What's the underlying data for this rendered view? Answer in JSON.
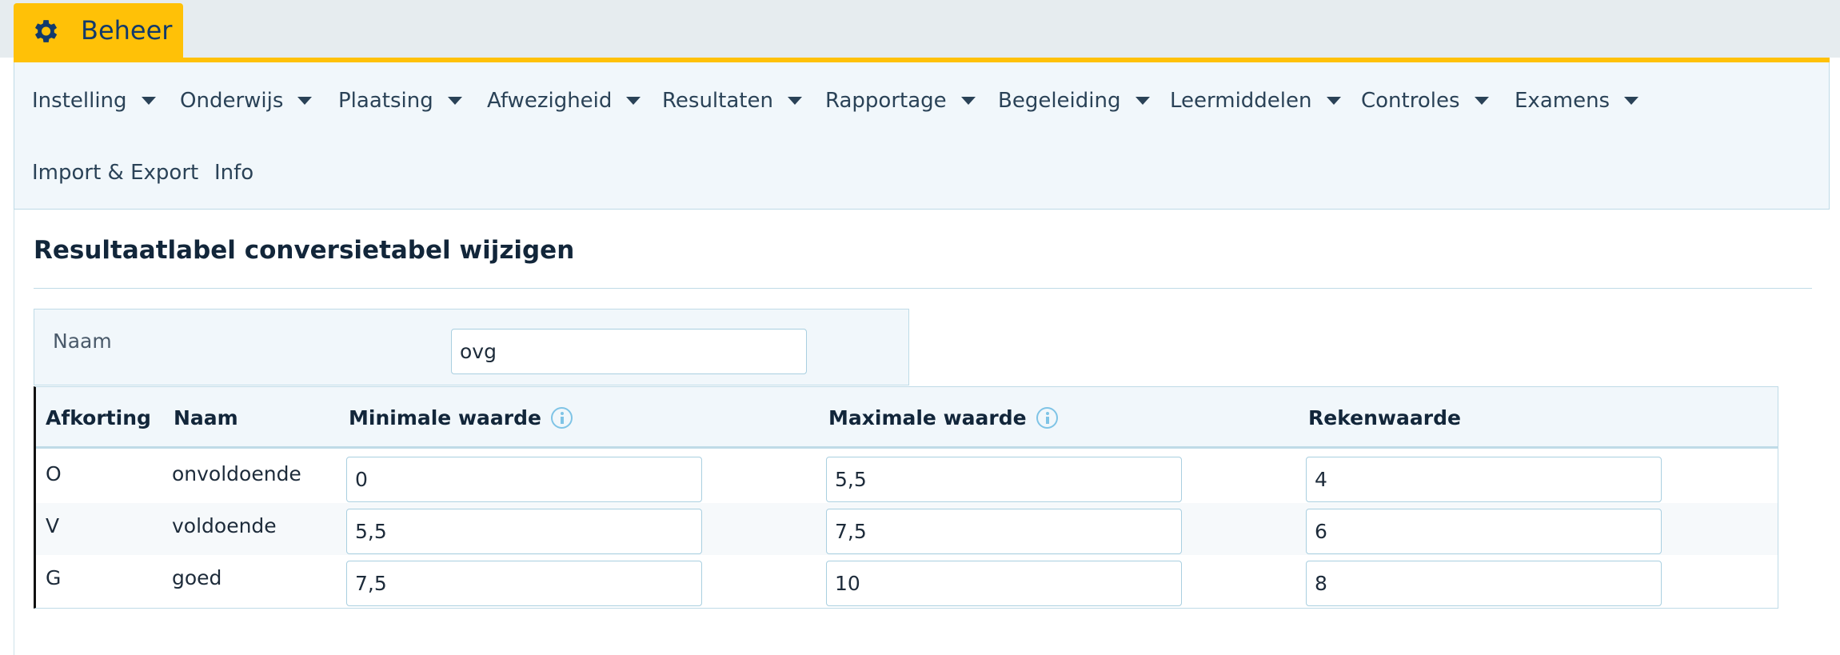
{
  "app": {
    "tab_label": "Beheer",
    "accent_color": "#ffc107",
    "brand_color": "#123a6b"
  },
  "menu": {
    "items": [
      {
        "label": "Instelling",
        "has_dropdown": true
      },
      {
        "label": "Onderwijs",
        "has_dropdown": true
      },
      {
        "label": "Plaatsing",
        "has_dropdown": true
      },
      {
        "label": "Afwezigheid",
        "has_dropdown": true
      },
      {
        "label": "Resultaten",
        "has_dropdown": true
      },
      {
        "label": "Rapportage",
        "has_dropdown": true
      },
      {
        "label": "Begeleiding",
        "has_dropdown": true
      },
      {
        "label": "Leermiddelen",
        "has_dropdown": true
      },
      {
        "label": "Controles",
        "has_dropdown": true
      },
      {
        "label": "Examens",
        "has_dropdown": true
      },
      {
        "label": "Import & Export",
        "has_dropdown": false
      },
      {
        "label": "Info",
        "has_dropdown": false
      }
    ]
  },
  "page": {
    "title": "Resultaatlabel conversietabel wijzigen"
  },
  "form": {
    "name_label": "Naam",
    "name_value": "ovg"
  },
  "table": {
    "headers": {
      "abbr": "Afkorting",
      "name": "Naam",
      "min": "Minimale waarde",
      "max": "Maximale waarde",
      "calc": "Rekenwaarde"
    },
    "rows": [
      {
        "abbr": "O",
        "name": "onvoldoende",
        "min": "0",
        "max": "5,5",
        "calc": "4"
      },
      {
        "abbr": "V",
        "name": "voldoende",
        "min": "5,5",
        "max": "7,5",
        "calc": "6"
      },
      {
        "abbr": "G",
        "name": "goed",
        "min": "7,5",
        "max": "10",
        "calc": "8"
      }
    ]
  }
}
